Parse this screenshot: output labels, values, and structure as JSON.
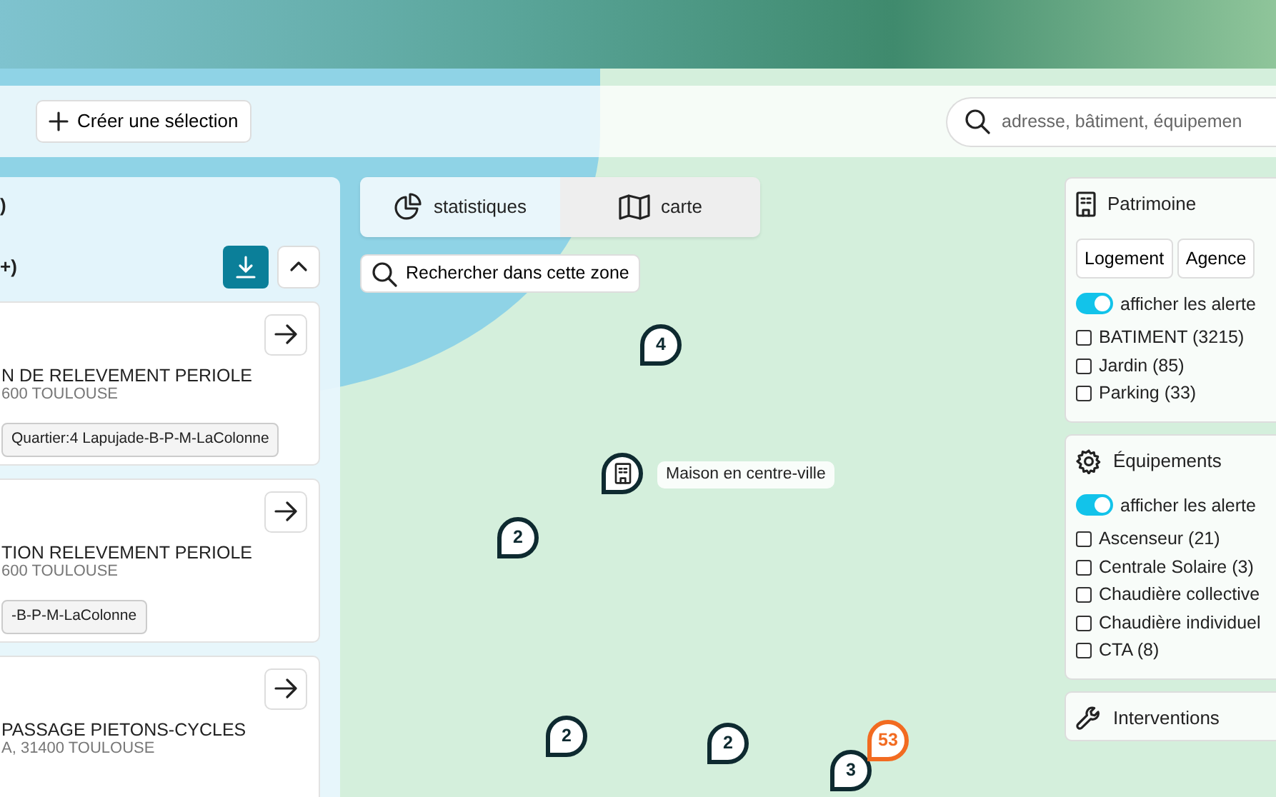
{
  "toolbar": {
    "create_button": "Créer une sélection",
    "search": {
      "placeholder": "adresse, bâtiment, équipemen"
    }
  },
  "results_panel": {
    "title_fragment": ")",
    "count_fragment": "+)",
    "cards": [
      {
        "title": "N DE RELEVEMENT PERIOLE",
        "address": "600 TOULOUSE",
        "tags": [
          "Quartier:4 Lapujade-B-P-M-LaColonne"
        ]
      },
      {
        "title": "TION RELEVEMENT PERIOLE",
        "address": "600 TOULOUSE",
        "tags": [
          "-B-P-M-LaColonne"
        ]
      },
      {
        "title": "PASSAGE PIETONS-CYCLES",
        "address": "A, 31400 TOULOUSE"
      }
    ]
  },
  "view_tabs": [
    {
      "label": "statistiques",
      "kind": "chart",
      "selected": true
    },
    {
      "label": "carte",
      "kind": "map",
      "selected": false
    }
  ],
  "zone_search": "Rechercher dans cette zone",
  "filter_panels": [
    {
      "title": "Patrimoine",
      "kind": "building",
      "type_buttons": [
        "Logement",
        "Agence"
      ],
      "alerts_toggle": {
        "label": "afficher les alerte",
        "on": true
      },
      "options": [
        {
          "label": "BATIMENT (3215)",
          "checked": false
        },
        {
          "label": "Jardin (85)",
          "checked": false
        },
        {
          "label": "Parking (33)",
          "checked": false
        }
      ]
    },
    {
      "title": "Équipements",
      "kind": "gear",
      "alerts_toggle": {
        "label": "afficher les alerte",
        "on": true
      },
      "options": [
        {
          "label": "Ascenseur (21)",
          "checked": false
        },
        {
          "label": "Centrale Solaire (3)",
          "checked": false
        },
        {
          "label": "Chaudière collective",
          "checked": false
        },
        {
          "label": "Chaudière individuel",
          "checked": false
        },
        {
          "label": "CTA (8)",
          "checked": false
        }
      ]
    },
    {
      "title": "Interventions",
      "kind": "wrench"
    }
  ],
  "map": {
    "markers": [
      {
        "kind": "cluster",
        "count": "4",
        "color": "#0e2a30"
      },
      {
        "kind": "building",
        "label": "Maison en centre-ville",
        "color": "#0e2a30"
      },
      {
        "kind": "cluster",
        "count": "2",
        "color": "#0e2a30"
      },
      {
        "kind": "cluster",
        "count": "2",
        "color": "#0e2a30"
      },
      {
        "kind": "cluster",
        "count": "2",
        "color": "#0e2a30"
      },
      {
        "kind": "cluster",
        "count": "3",
        "color": "#0e2a30"
      },
      {
        "kind": "cluster",
        "count": "53",
        "color": "#f26b21"
      }
    ]
  }
}
